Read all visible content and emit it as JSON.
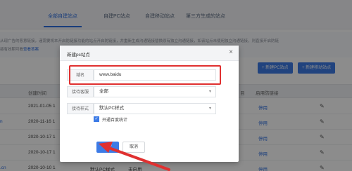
{
  "tabs": [
    {
      "label": "全部自建站点",
      "active": true
    },
    {
      "label": "自建PC站点",
      "active": false
    },
    {
      "label": "自建移动站点",
      "active": false
    },
    {
      "label": "第三方生成的站点",
      "active": false
    }
  ],
  "notice": {
    "line1": "从现广告的恶意链接，谨需要将本开启防链接功能的站点开启防链接，并重新生成沟通链接替换原有独立沟通链接，如该站点未使用独立沟通链接，则直接开启防链",
    "line2_prefix": "接",
    "line2_rest": "有效期可看",
    "line2_link": "查看答案",
    "right1": "",
    "right2": ""
  },
  "toolbar": {
    "new_pc": "+ 新建PC站点",
    "new_mobile": "+ 新建移动站点"
  },
  "table": {
    "headers": [
      "创建时间",
      "目",
      "启用防链接"
    ],
    "rows": [
      {
        "lead": "",
        "date": "2021-01-05 1",
        "action": "停用"
      },
      {
        "lead": "n",
        "date": "2020-11-16 1",
        "action": "停用"
      },
      {
        "lead": "",
        "date": "2020-10-17 1",
        "action": "停用"
      },
      {
        "lead": "",
        "date": "2020-10-17 1",
        "action": "停用"
      },
      {
        "lead": ".cn",
        "date": "2020-10-10 1",
        "style": "默认PC样式",
        "source": "未启用",
        "action": "停用"
      }
    ]
  },
  "modal": {
    "title": "新建pc站点",
    "close": "×",
    "fields": {
      "domain_label": "域名",
      "domain_value": "www.baidu",
      "group_label": "接待客服",
      "group_value": "全部",
      "style_label": "接待样式",
      "style_value": "默认PC样式"
    },
    "checkbox_label": "开通百度统计",
    "confirm": "确定",
    "cancel": "取消"
  },
  "colors": {
    "accent": "#3c7be6",
    "highlight": "#e03030",
    "arrow": "#e03030"
  }
}
